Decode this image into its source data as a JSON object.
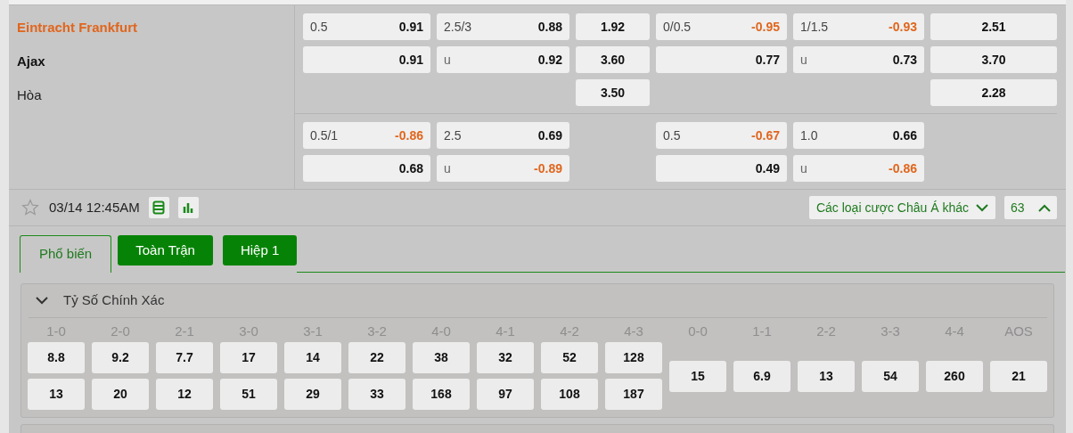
{
  "match": {
    "teams": [
      {
        "kind": "home",
        "name": "Eintracht Frankfurt"
      },
      {
        "kind": "away",
        "name": "Ajax"
      },
      {
        "kind": "draw",
        "name": "Hòa"
      }
    ],
    "groups": [
      {
        "rows": [
          [
            {
              "kind": "pair",
              "line": "0.5",
              "odds": "0.91",
              "negative": false
            },
            {
              "kind": "pair",
              "line": "2.5/3",
              "odds": "0.88",
              "negative": false
            },
            {
              "kind": "single",
              "odds": "1.92"
            },
            {
              "kind": "pair",
              "line": "0/0.5",
              "odds": "-0.95",
              "negative": true
            },
            {
              "kind": "pair",
              "line": "1/1.5",
              "odds": "-0.93",
              "negative": true
            },
            {
              "kind": "single",
              "odds": "2.51"
            }
          ],
          [
            {
              "kind": "pair",
              "odds": "0.91",
              "negative": false
            },
            {
              "kind": "pair",
              "line": "u",
              "odds": "0.92",
              "negative": false
            },
            {
              "kind": "single",
              "odds": "3.60"
            },
            {
              "kind": "pair",
              "odds": "0.77",
              "negative": false
            },
            {
              "kind": "pair",
              "line": "u",
              "odds": "0.73",
              "negative": false
            },
            {
              "kind": "single",
              "odds": "3.70"
            }
          ],
          [
            {
              "kind": "empty"
            },
            {
              "kind": "empty"
            },
            {
              "kind": "single",
              "odds": "3.50"
            },
            {
              "kind": "empty"
            },
            {
              "kind": "empty"
            },
            {
              "kind": "single",
              "odds": "2.28"
            }
          ]
        ]
      },
      {
        "rows": [
          [
            {
              "kind": "pair",
              "line": "0.5/1",
              "odds": "-0.86",
              "negative": true
            },
            {
              "kind": "pair",
              "line": "2.5",
              "odds": "0.69",
              "negative": false
            },
            {
              "kind": "empty"
            },
            {
              "kind": "pair",
              "line": "0.5",
              "odds": "-0.67",
              "negative": true
            },
            {
              "kind": "pair",
              "line": "1.0",
              "odds": "0.66",
              "negative": false
            },
            {
              "kind": "empty"
            }
          ],
          [
            {
              "kind": "pair",
              "odds": "0.68",
              "negative": false
            },
            {
              "kind": "pair",
              "line": "u",
              "odds": "-0.89",
              "negative": true
            },
            {
              "kind": "empty"
            },
            {
              "kind": "pair",
              "odds": "0.49",
              "negative": false
            },
            {
              "kind": "pair",
              "line": "u",
              "odds": "-0.86",
              "negative": true
            },
            {
              "kind": "empty"
            }
          ]
        ]
      }
    ]
  },
  "info_bar": {
    "favorite": false,
    "datetime": "03/14 12:45AM",
    "more_bets": "Các loại cược Châu Á khác",
    "count": "63",
    "expanded": true
  },
  "tabs": [
    {
      "label": "Phổ biến",
      "selected": true
    },
    {
      "label": "Toàn Trận",
      "selected": false
    },
    {
      "label": "Hiệp 1",
      "selected": false
    }
  ],
  "correct_score": {
    "title": "Tỷ Số Chính Xác",
    "expanded": true,
    "scores": [
      {
        "label": "1-0",
        "values": [
          "8.8",
          "13"
        ]
      },
      {
        "label": "2-0",
        "values": [
          "9.2",
          "20"
        ]
      },
      {
        "label": "2-1",
        "values": [
          "7.7",
          "12"
        ]
      },
      {
        "label": "3-0",
        "values": [
          "17",
          "51"
        ]
      },
      {
        "label": "3-1",
        "values": [
          "14",
          "29"
        ]
      },
      {
        "label": "3-2",
        "values": [
          "22",
          "33"
        ]
      },
      {
        "label": "4-0",
        "values": [
          "38",
          "168"
        ]
      },
      {
        "label": "4-1",
        "values": [
          "32",
          "97"
        ]
      },
      {
        "label": "4-2",
        "values": [
          "52",
          "108"
        ]
      },
      {
        "label": "4-3",
        "values": [
          "128",
          "187"
        ]
      },
      {
        "label": "0-0",
        "values": [
          "15"
        ]
      },
      {
        "label": "1-1",
        "values": [
          "6.9"
        ]
      },
      {
        "label": "2-2",
        "values": [
          "13"
        ]
      },
      {
        "label": "3-3",
        "values": [
          "54"
        ]
      },
      {
        "label": "4-4",
        "values": [
          "260"
        ]
      },
      {
        "label": "AOS",
        "values": [
          "21"
        ]
      }
    ]
  }
}
